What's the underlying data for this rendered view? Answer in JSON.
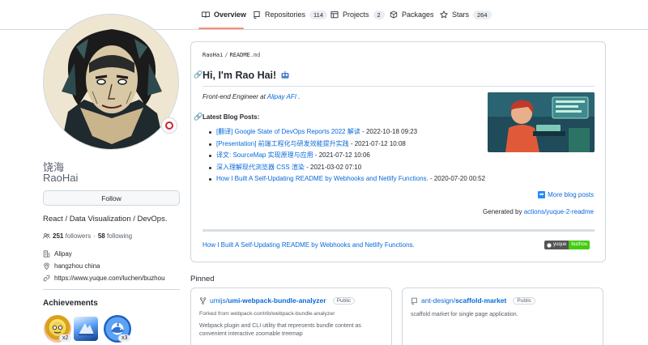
{
  "tabs": [
    {
      "label": "Overview",
      "count": null,
      "icon": "book-open-icon"
    },
    {
      "label": "Repositories",
      "count": "114",
      "icon": "repo-icon"
    },
    {
      "label": "Projects",
      "count": "2",
      "icon": "table-icon"
    },
    {
      "label": "Packages",
      "count": null,
      "icon": "package-icon"
    },
    {
      "label": "Stars",
      "count": "264",
      "icon": "star-icon"
    }
  ],
  "profile": {
    "name": "饶海",
    "login": "RaoHai",
    "follow_label": "Follow",
    "bio": "React / Data Visualization / DevOps.",
    "followers_count": "251",
    "followers_label": "followers",
    "dot": "·",
    "following_count": "58",
    "following_label": "following",
    "company": "Alipay",
    "location": "hangzhou china",
    "website": "https://www.yuque.com/luchen/buzhou"
  },
  "achievements": {
    "title": "Achievements",
    "badges": [
      {
        "name": "quickdraw",
        "count": "x2"
      },
      {
        "name": "arctic-code-vault",
        "count": null
      },
      {
        "name": "pull-shark",
        "count": "x3"
      }
    ]
  },
  "readme": {
    "crumb_user": "RaoHai",
    "crumb_sep": "/",
    "crumb_file": "README",
    "crumb_ext": ".md",
    "heading": "Hi, I'm Rao Hai!",
    "role_prefix": "Front-end Engineer at ",
    "role_link": "Alipay AFI",
    "role_suffix": " .",
    "posts_heading": "Latest Blog Posts:",
    "posts": [
      {
        "title": "[翻译] Google State of DevOps Reports 2022 解读",
        "date": " - 2022-10-18 09:23"
      },
      {
        "title": "[Presentation] 前端工程化与研发效能提升实践",
        "date": " - 2021-07-12 10:08"
      },
      {
        "title": "译文: SourceMap 实现原理与应用",
        "date": " - 2021-07-12 10:06"
      },
      {
        "title": "深入理解现代浏览器 CSS 渲染",
        "date": " - 2021-03-02 07:10"
      },
      {
        "title": "How I Built A Self-Updating README by Webhooks and Netlify Functions.",
        "date": " - 2020-07-20 00:52"
      }
    ],
    "more_label": "More blog posts",
    "generated_prefix": "Generated by ",
    "generated_link": "actions/yuque-2-readme",
    "footer_link": "How I Built A Self-Updating README by Webhooks and Netlify Functions.",
    "badge_left": "yuque",
    "badge_right": "buzhou"
  },
  "pinned": {
    "title": "Pinned",
    "cards": [
      {
        "owner": "umijs/",
        "repo": "umi-webpack-bundle-analyzer",
        "visibility": "Public",
        "fork_note": "Forked from webpack-contrib/webpack-bundle-analyzer",
        "description": "Webpack plugin and CLI utility that represents bundle content as convenient interactive zoomable treemap"
      },
      {
        "owner": "ant-design/",
        "repo": "scaffold-market",
        "visibility": "Public",
        "fork_note": "",
        "description": "scaffold market for single page application."
      }
    ]
  },
  "colors": {
    "accent": "#0969da",
    "tab_underline": "#fd8c73",
    "border": "#d0d7de",
    "muted": "#57606a"
  }
}
